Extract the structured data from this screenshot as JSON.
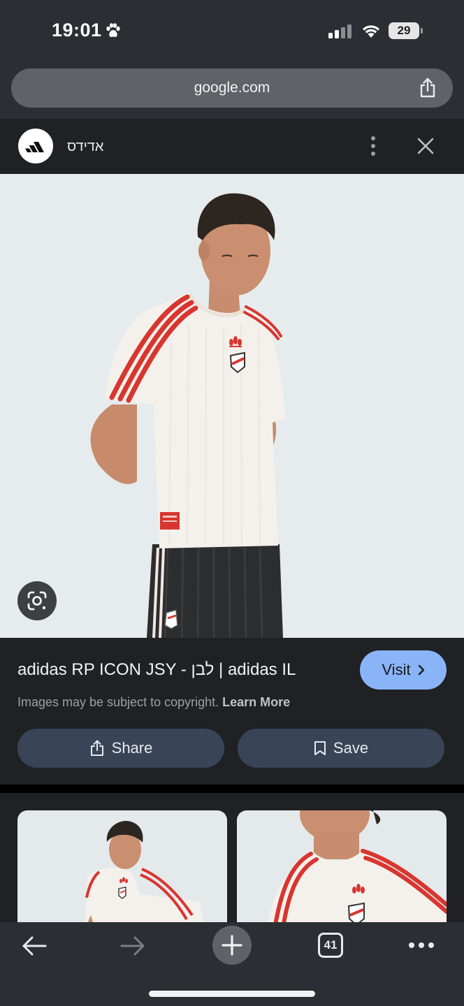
{
  "status_bar": {
    "time": "19:01",
    "battery": "29",
    "icons": [
      "paw-icon",
      "signal-icon",
      "wifi-icon",
      "battery-icon"
    ]
  },
  "browser": {
    "url": "google.com",
    "share_icon": "share-icon"
  },
  "site": {
    "name": "אדידס",
    "logo": "adidas-logo",
    "icons": [
      "more-vert-icon",
      "close-icon"
    ]
  },
  "result": {
    "title": "adidas RP ICON JSY - לבן | adidas IL",
    "visit_label": "Visit",
    "copyright_text": "Images may be subject to copyright.",
    "learn_more": "Learn More",
    "share_label": "Share",
    "save_label": "Save"
  },
  "toolbar": {
    "tab_count": "41",
    "icons": [
      "back-icon",
      "forward-icon",
      "plus-icon",
      "tabs-icon",
      "more-horiz-icon"
    ]
  },
  "colors": {
    "background": "#202124",
    "browser_chrome": "#2b2f33",
    "accent_visit": "#8ab4f8",
    "action_button": "#394457",
    "jersey_stripe": "#d9352f"
  }
}
